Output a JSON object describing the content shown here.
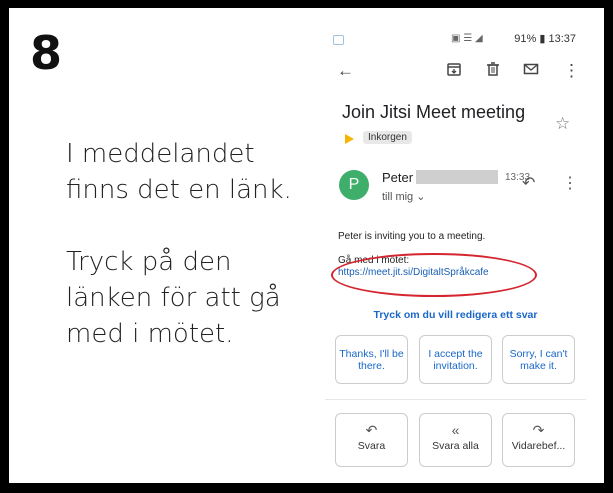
{
  "step_number": "8",
  "instruction_1": [
    "I meddelandet",
    "finns det en länk."
  ],
  "instruction_2": [
    "Tryck på den",
    "länken för att gå",
    "med i mötet."
  ],
  "status_bar": {
    "battery": "91%",
    "time": "13:37"
  },
  "email": {
    "subject": "Join Jitsi Meet meeting",
    "label": "Inkorgen",
    "sender_avatar_letter": "P",
    "sender_name": "Peter",
    "time": "13:33",
    "to": "till mig",
    "body_line_1": "Peter is inviting you to a meeting.",
    "body_line_2": "Gå med i mötet:",
    "link": "https://meet.jit.si/DigitaltSpråkcafe",
    "edit_prompt": "Tryck om du vill redigera ett svar",
    "smart_replies": [
      "Thanks, I'll be there.",
      "I accept the invitation.",
      "Sorry, I can't make it."
    ],
    "actions": [
      "Svara",
      "Svara alla",
      "Vidarebef..."
    ]
  },
  "colors": {
    "avatar": "#3fae6a",
    "link": "#1a5fb4",
    "highlight_circle": "#d4262e",
    "label_arrow": "#f5b400"
  }
}
